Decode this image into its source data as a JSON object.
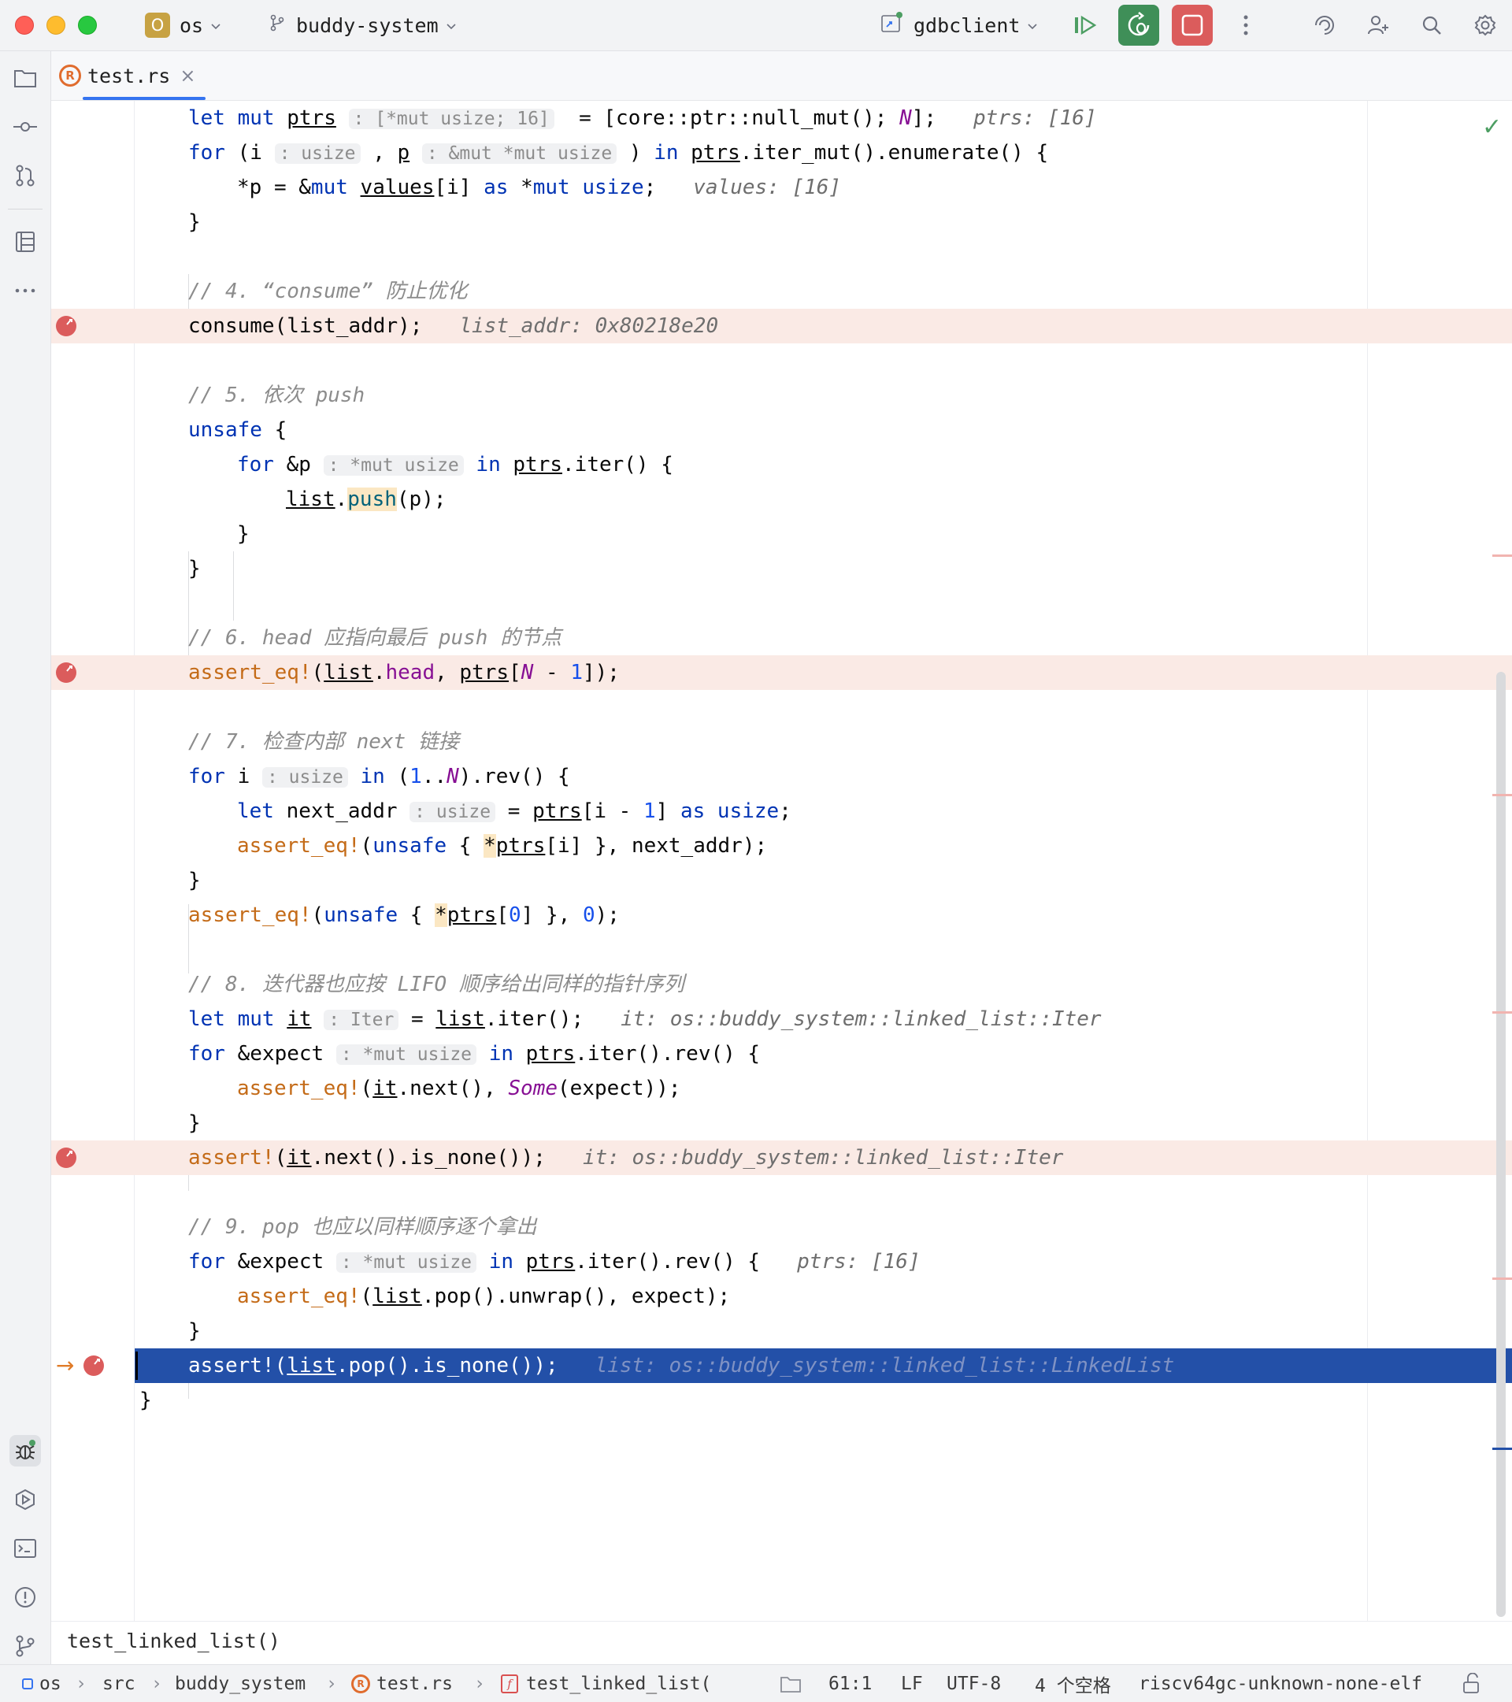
{
  "titlebar": {
    "project_badge": "O",
    "project": "os",
    "branch": "buddy-system",
    "run_config": "gdbclient"
  },
  "tab": {
    "label": "test.rs",
    "close": "×"
  },
  "lines": {
    "l1": {
      "c1": "let ",
      "c2": "mut ",
      "c3": "ptrs",
      "h1": ": [*mut usize; 16]",
      "c4": " = [core::ptr::null_mut(); ",
      "c5": "N",
      "c6": "];",
      "d1": "ptrs: [16]"
    },
    "l2": {
      "c1": "for ",
      "c2": "(i",
      "h1": ": usize",
      "c3": ", ",
      "c4": "p",
      "h2": ": &mut *mut usize",
      "c5": ") ",
      "c6": "in ",
      "c7": "ptrs",
      "c8": ".iter_mut().enumerate() {"
    },
    "l3": {
      "c1": "*p = &",
      "c2": "mut ",
      "c3": "values",
      "c4": "[i] ",
      "c5": "as ",
      "c6": "*",
      "c7": "mut ",
      "c8": "usize",
      "c9": ";",
      "d1": "values: [16]"
    },
    "l4": {
      "c1": "}"
    },
    "l6": {
      "c1": "// 4. “consume” 防止优化"
    },
    "l7": {
      "c1": "consume(list_addr);",
      "d1": "list_addr: 0x80218e20"
    },
    "l9": {
      "c1": "// 5. 依次 push"
    },
    "l10": {
      "c1": "unsafe",
      "c2": " {"
    },
    "l11": {
      "c1": "for ",
      "c2": "&p",
      "h1": ": *mut usize",
      "c3": " ",
      "c4": "in ",
      "c5": "ptrs",
      "c6": ".iter() {"
    },
    "l12": {
      "c1": "list",
      "c2": ".",
      "c3": "push",
      "c4": "(p);"
    },
    "l13": {
      "c1": "}"
    },
    "l14": {
      "c1": "}"
    },
    "l16": {
      "c1": "// 6. head 应指向最后 push 的节点"
    },
    "l17": {
      "c1": "assert_eq!",
      "c2": "(",
      "c3": "list",
      "c4": ".",
      "c5": "head",
      "c6": ", ",
      "c7": "ptrs",
      "c8": "[",
      "c9": "N",
      "c10": " - ",
      "c11": "1",
      "c12": "]);"
    },
    "l19": {
      "c1": "// 7. 检查内部 next 链接"
    },
    "l20": {
      "c1": "for ",
      "c2": "i",
      "h1": ": usize",
      "c3": " ",
      "c4": "in ",
      "c5": "(",
      "c6": "1",
      "c7": "..",
      "c8": "N",
      "c9": ").rev() {"
    },
    "l21": {
      "c1": "let ",
      "c2": "next_addr",
      "h1": ": usize",
      "c3": " = ",
      "c4": "ptrs",
      "c5": "[i - ",
      "c6": "1",
      "c7": "] ",
      "c8": "as ",
      "c9": "usize",
      "c10": ";"
    },
    "l22": {
      "c1": "assert_eq!",
      "c2": "(",
      "c3": "unsafe",
      "c4": " { ",
      "c5": "*",
      "c6": "ptrs",
      "c7": "[i] }, next_addr);"
    },
    "l23": {
      "c1": "}"
    },
    "l24": {
      "c1": "assert_eq!",
      "c2": "(",
      "c3": "unsafe",
      "c4": " { ",
      "c5": "*",
      "c6": "ptrs",
      "c7": "[",
      "c8": "0",
      "c9": "] }, ",
      "c10": "0",
      "c11": ");"
    },
    "l26": {
      "c1": "// 8. 迭代器也应按 LIFO 顺序给出同样的指针序列"
    },
    "l27": {
      "c1": "let ",
      "c2": "mut ",
      "c3": "it",
      "h1": ": Iter",
      "c4": " = ",
      "c5": "list",
      "c6": ".iter();",
      "d1": "it: os::buddy_system::linked_list::Iter"
    },
    "l28": {
      "c1": "for ",
      "c2": "&expect",
      "h1": ": *mut usize",
      "c3": " ",
      "c4": "in ",
      "c5": "ptrs",
      "c6": ".iter().rev() {"
    },
    "l29": {
      "c1": "assert_eq!",
      "c2": "(",
      "c3": "it",
      "c4": ".next(), ",
      "c5": "Some",
      "c6": "(expect));"
    },
    "l30": {
      "c1": "}"
    },
    "l31": {
      "c1": "assert!",
      "c2": "(",
      "c3": "it",
      "c4": ".next().is_none());",
      "d1": "it: os::buddy_system::linked_list::Iter"
    },
    "l33": {
      "c1": "// 9. pop 也应以同样顺序逐个拿出"
    },
    "l34": {
      "c1": "for ",
      "c2": "&expect",
      "h1": ": *mut usize",
      "c3": " ",
      "c4": "in ",
      "c5": "ptrs",
      "c6": ".iter().rev() {",
      "d1": "ptrs: [16]"
    },
    "l35": {
      "c1": "assert_eq!",
      "c2": "(",
      "c3": "list",
      "c4": ".pop().unwrap(), expect);"
    },
    "l36": {
      "c1": "}"
    },
    "l37": {
      "c1": "assert!(",
      "c2": "list",
      "c3": ".pop().is_none());",
      "d1": "list: os::buddy_system::linked_list::LinkedList"
    },
    "l38": {
      "c1": "}"
    }
  },
  "exec_arrow": "→",
  "check_mark": "✓",
  "editor_footer": {
    "function": "test_linked_list()"
  },
  "statusbar": {
    "crumb_os": "os",
    "sep": "›",
    "crumb_src": "src",
    "crumb_dir": "buddy_system",
    "crumb_file": "test.rs",
    "crumb_fn": "test_linked_list(",
    "position": "61:1",
    "line_ending": "LF",
    "encoding": "UTF-8",
    "indent": "4 个空格",
    "target": "riscv64gc-unknown-none-elf"
  },
  "colors": {
    "keyword": "#0033b3",
    "macro": "#c46b18",
    "comment": "#8c8c8c",
    "breakpoint_line": "#faeae5",
    "current_line": "#2350a8",
    "debug_button": "#3f8f58",
    "stop_button": "#db5c5c",
    "accent": "#3574f0"
  },
  "icons": {
    "left_strip": [
      "folder-icon",
      "commit-icon",
      "pull-request-icon",
      "structure-icon",
      "more-icon",
      "debug-icon",
      "run-icon",
      "terminal-icon",
      "problems-icon",
      "git-icon"
    ],
    "title_right": [
      "resume-icon",
      "debug-icon",
      "stop-icon",
      "kebab-icon",
      "ai-icon",
      "add-user-icon",
      "search-icon",
      "settings-icon"
    ]
  }
}
